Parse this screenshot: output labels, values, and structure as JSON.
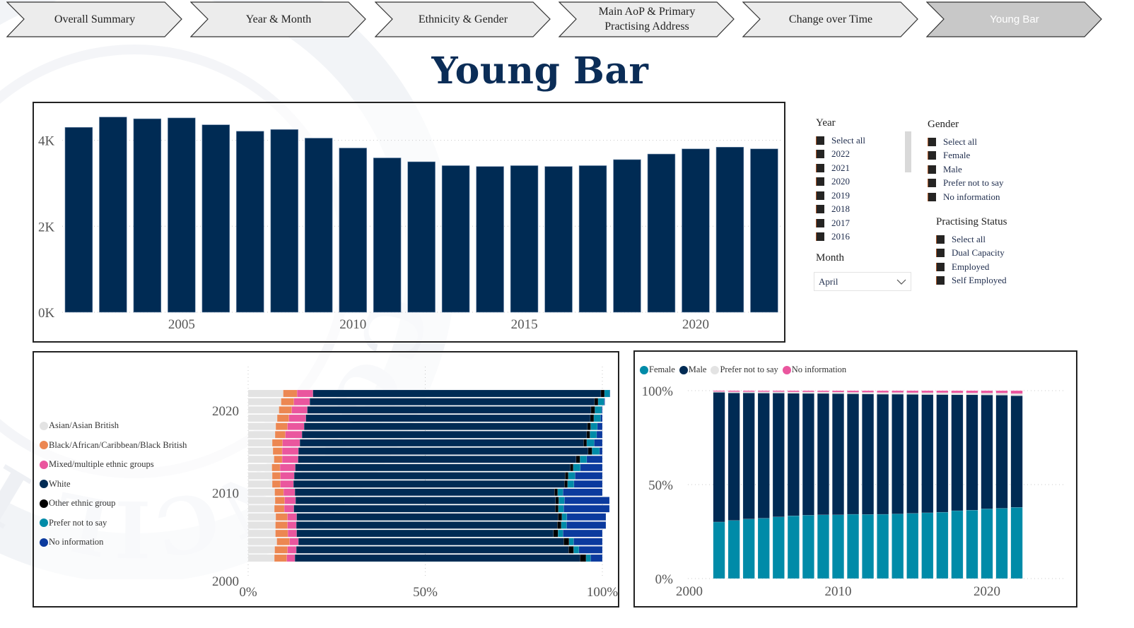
{
  "nav": {
    "tabs": [
      {
        "label": "Overall Summary",
        "active": false
      },
      {
        "label": "Year & Month",
        "active": false
      },
      {
        "label": "Ethnicity & Gender",
        "active": false
      },
      {
        "label": "Main AoP & Primary Practising Address",
        "active": false
      },
      {
        "label": "Change over Time",
        "active": false
      },
      {
        "label": "Young Bar",
        "active": true
      }
    ]
  },
  "page_title": "Young Bar",
  "colors": {
    "navy": "#002b54",
    "teal": "#008ba8",
    "pink": "#ea569e",
    "orange": "#ec8752",
    "light_gray": "#e3e3e3",
    "black": "#000000",
    "royal_blue": "#0b3a9e",
    "tab_bg": "#ececec",
    "tab_active_bg": "#c8c8c8"
  },
  "filters": {
    "year": {
      "title": "Year",
      "items": [
        "Select all",
        "2022",
        "2021",
        "2020",
        "2019",
        "2018",
        "2017",
        "2016"
      ]
    },
    "month": {
      "title": "Month",
      "selected": "April"
    },
    "gender": {
      "title": "Gender",
      "items": [
        "Select all",
        "Female",
        "Male",
        "Prefer not to say",
        "No information"
      ]
    },
    "practising_status": {
      "title": "Practising Status",
      "items": [
        "Select all",
        "Dual Capacity",
        "Employed",
        "Self Employed"
      ]
    }
  },
  "chart_data": [
    {
      "id": "count",
      "type": "bar",
      "title": "",
      "xlabel": "",
      "ylabel": "",
      "categories": [
        2002,
        2003,
        2004,
        2005,
        2006,
        2007,
        2008,
        2009,
        2010,
        2011,
        2012,
        2013,
        2014,
        2015,
        2016,
        2017,
        2018,
        2019,
        2020,
        2021,
        2022
      ],
      "values": [
        4300,
        4540,
        4500,
        4520,
        4360,
        4210,
        4250,
        4050,
        3820,
        3590,
        3500,
        3410,
        3390,
        3410,
        3390,
        3410,
        3550,
        3680,
        3800,
        3840,
        3800
      ],
      "ylim": [
        0,
        4700
      ],
      "yticks": [
        {
          "value": 0,
          "label": "0K"
        },
        {
          "value": 2000,
          "label": "2K"
        },
        {
          "value": 4000,
          "label": "4K"
        }
      ],
      "xticks": [
        2005,
        2010,
        2015,
        2020
      ],
      "grid": true
    },
    {
      "id": "ethnicity",
      "type": "bar",
      "orientation": "horizontal-stacked-100",
      "title": "",
      "legend_position": "left",
      "categories": [
        2002,
        2003,
        2004,
        2005,
        2006,
        2007,
        2008,
        2009,
        2010,
        2011,
        2012,
        2013,
        2014,
        2015,
        2016,
        2017,
        2018,
        2019,
        2020,
        2021,
        2022
      ],
      "xticks": [
        "0%",
        "50%",
        "100%"
      ],
      "yticks": [
        2000,
        2010,
        2020
      ],
      "ylim": [
        2000,
        2022.7
      ],
      "series": [
        {
          "name": "Asian/Asian British",
          "color": "#e3e3e3",
          "values": [
            7.4,
            7.5,
            8.1,
            7.7,
            7.7,
            7.8,
            7.4,
            7.6,
            7.5,
            6.8,
            6.8,
            6.7,
            7.3,
            7.0,
            6.8,
            7.6,
            7.8,
            8.2,
            8.7,
            9.3,
            9.9
          ]
        },
        {
          "name": "Black/African/Caribbean/Black British",
          "color": "#ec8752",
          "values": [
            3.5,
            3.6,
            3.6,
            3.5,
            3.4,
            3.3,
            2.8,
            2.7,
            2.5,
            2.3,
            2.3,
            2.3,
            2.3,
            2.6,
            2.9,
            2.9,
            3.3,
            3.3,
            3.6,
            3.6,
            3.9
          ]
        },
        {
          "name": "Mixed/multiple ethnic groups",
          "color": "#ea569e",
          "values": [
            2.3,
            2.5,
            2.5,
            2.5,
            2.5,
            2.6,
            2.7,
            3.1,
            3.2,
            3.7,
            3.9,
            4.3,
            4.5,
            4.6,
            4.9,
            4.7,
            4.7,
            4.8,
            4.4,
            4.5,
            4.5
          ]
        },
        {
          "name": "White",
          "color": "#002b54",
          "values": [
            80.5,
            76.9,
            74.9,
            72.5,
            73.7,
            73.8,
            73.8,
            73.4,
            73.3,
            76.5,
            76.5,
            77.6,
            78.5,
            81.8,
            80.1,
            80.4,
            80.0,
            80.3,
            80.1,
            80.4,
            81.3
          ]
        },
        {
          "name": "Other ethnic group",
          "color": "#000000",
          "values": [
            1.7,
            1.4,
            1.5,
            1.3,
            1.1,
            1.1,
            0.9,
            0.9,
            0.9,
            0.9,
            0.9,
            0.9,
            1.1,
            1.1,
            0.9,
            0.9,
            0.9,
            1.0,
            1.1,
            1.0,
            1.0
          ]
        },
        {
          "name": "Prefer not to say",
          "color": "#008ba8",
          "values": [
            1.3,
            1.5,
            1.3,
            1.4,
            1.5,
            1.4,
            1.5,
            1.6,
            1.5,
            1.8,
            1.9,
            2.0,
            1.9,
            2.1,
            2.1,
            1.9,
            1.9,
            1.9,
            1.9,
            1.7,
            1.5
          ]
        },
        {
          "name": "No information",
          "color": "#0b3a9e",
          "values": [
            3.3,
            6.6,
            8.1,
            11.1,
            11.1,
            11.0,
            12.9,
            12.7,
            11.1,
            8.0,
            7.7,
            6.2,
            4.4,
            0.8,
            2.3,
            1.6,
            1.4,
            0.5,
            0.2,
            0.2,
            0.1
          ]
        }
      ]
    },
    {
      "id": "gender",
      "type": "bar",
      "orientation": "vertical-stacked-100",
      "title": "",
      "legend_position": "top-left",
      "categories": [
        2002,
        2003,
        2004,
        2005,
        2006,
        2007,
        2008,
        2009,
        2010,
        2011,
        2012,
        2013,
        2014,
        2015,
        2016,
        2017,
        2018,
        2019,
        2020,
        2021,
        2022
      ],
      "xticks": [
        2000,
        2010,
        2020
      ],
      "xlim": [
        2000,
        2025
      ],
      "yticks": [
        "0%",
        "50%",
        "100%"
      ],
      "ylim": [
        0,
        100
      ],
      "series": [
        {
          "name": "Female",
          "color": "#008ba8",
          "values": [
            30.1,
            30.9,
            31.7,
            32.1,
            32.8,
            33.4,
            33.7,
            33.9,
            33.9,
            34.2,
            34.1,
            34.2,
            34.4,
            34.7,
            35.0,
            35.3,
            36.1,
            36.4,
            37.1,
            37.4,
            37.9
          ]
        },
        {
          "name": "Male",
          "color": "#002b54",
          "values": [
            69.0,
            67.9,
            67.1,
            66.6,
            65.9,
            65.2,
            64.8,
            64.6,
            64.5,
            64.1,
            64.1,
            63.9,
            63.7,
            63.3,
            62.9,
            62.6,
            61.7,
            61.4,
            60.6,
            60.2,
            59.4
          ]
        },
        {
          "name": "Prefer not to say",
          "color": "#e3e3e3",
          "values": [
            0.4,
            0.6,
            0.6,
            0.7,
            0.7,
            0.7,
            0.8,
            0.8,
            0.8,
            0.8,
            0.9,
            0.9,
            0.9,
            0.9,
            1.0,
            1.0,
            1.0,
            1.0,
            1.0,
            1.1,
            1.1
          ]
        },
        {
          "name": "No information",
          "color": "#ea569e",
          "values": [
            0.5,
            0.6,
            0.6,
            0.6,
            0.6,
            0.7,
            0.7,
            0.7,
            0.8,
            0.9,
            0.9,
            1.0,
            1.0,
            1.1,
            1.1,
            1.1,
            1.2,
            1.2,
            1.3,
            1.3,
            1.6
          ]
        }
      ]
    }
  ]
}
